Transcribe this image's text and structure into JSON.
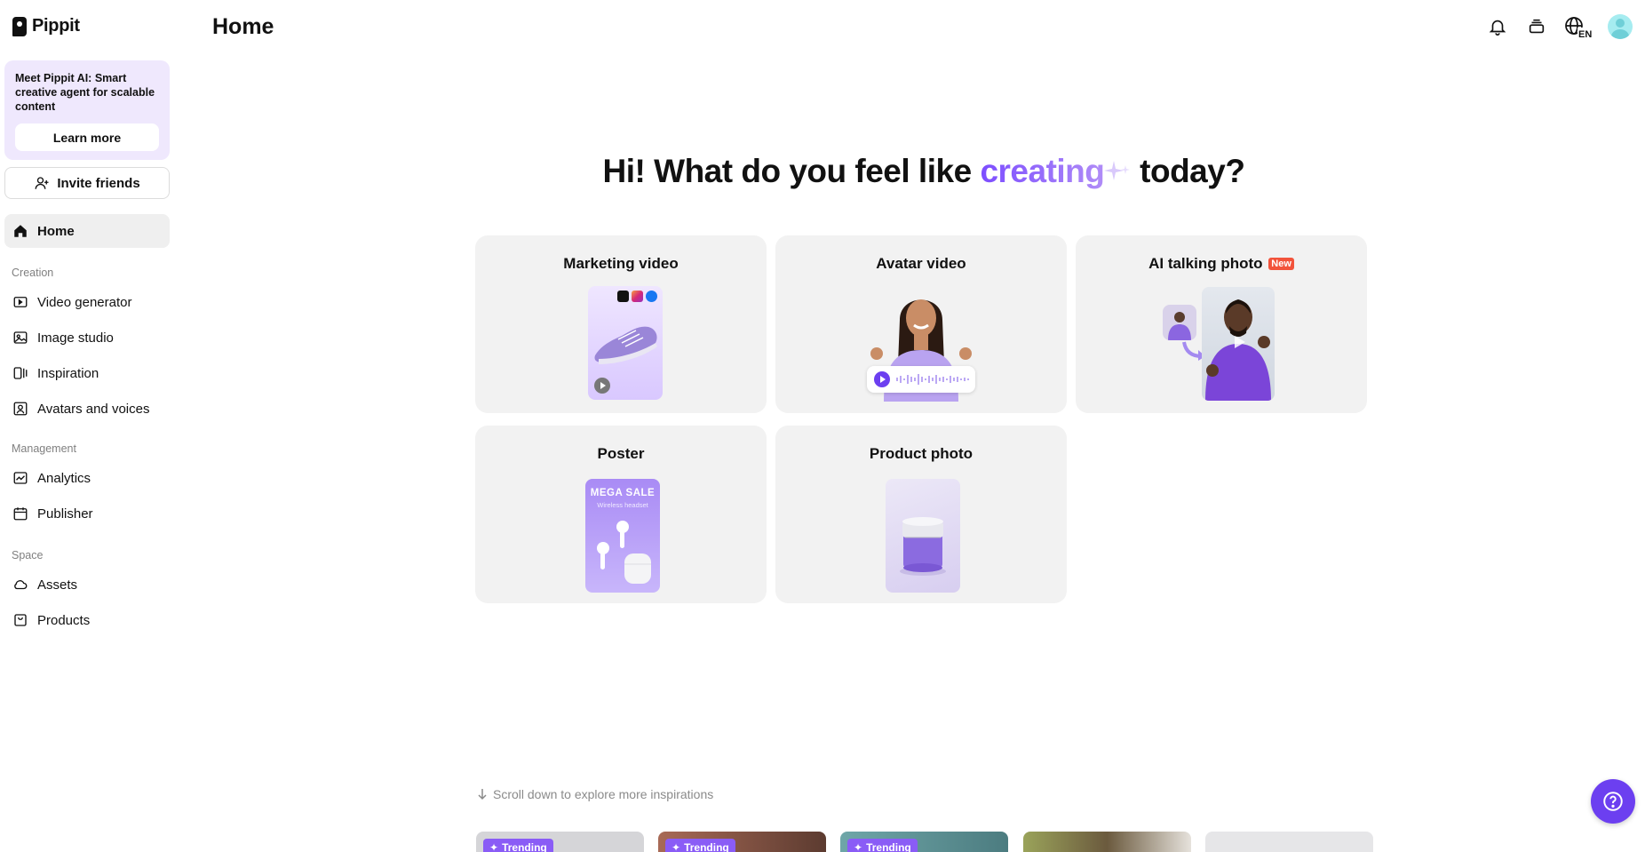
{
  "app": {
    "name": "Pippit"
  },
  "header": {
    "title": "Home"
  },
  "sidebar": {
    "promo": {
      "text": "Meet Pippit AI: Smart creative agent for scalable content",
      "button": "Learn more"
    },
    "invite_label": "Invite friends",
    "home_label": "Home",
    "sections": {
      "creation": "Creation",
      "management": "Management",
      "space": "Space"
    },
    "items": [
      {
        "label": "Video generator",
        "icon": "video-plus-icon"
      },
      {
        "label": "Image studio",
        "icon": "image-plus-icon"
      },
      {
        "label": "Inspiration",
        "icon": "panels-icon"
      },
      {
        "label": "Avatars and voices",
        "icon": "avatar-icon"
      },
      {
        "label": "Analytics",
        "icon": "chart-icon"
      },
      {
        "label": "Publisher",
        "icon": "calendar-icon"
      },
      {
        "label": "Assets",
        "icon": "cloud-icon"
      },
      {
        "label": "Products",
        "icon": "bag-icon"
      }
    ]
  },
  "hero": {
    "prefix": "Hi! What do you feel like ",
    "accent": "creating",
    "suffix": " today?"
  },
  "cards": [
    {
      "title": "Marketing video"
    },
    {
      "title": "Avatar video"
    },
    {
      "title": "AI talking photo",
      "badge": "New"
    },
    {
      "title": "Poster",
      "poster_headline": "MEGA SALE",
      "poster_sub": "Wireless headset"
    },
    {
      "title": "Product photo"
    }
  ],
  "scroll_hint": "Scroll down to explore more inspirations",
  "inspirations": [
    {
      "badge": "Trending"
    },
    {
      "badge": "Trending"
    },
    {
      "badge": "Trending"
    }
  ],
  "topbar": {
    "language": "EN",
    "icons": [
      "bell-icon",
      "credits-icon",
      "globe-icon",
      "avatar"
    ]
  },
  "colors": {
    "accent": "#7c4dff",
    "help": "#6c3ff0",
    "card_bg": "#f2f2f2",
    "promo_bg": "#efe8fd",
    "badge_new": "#f2533b"
  }
}
